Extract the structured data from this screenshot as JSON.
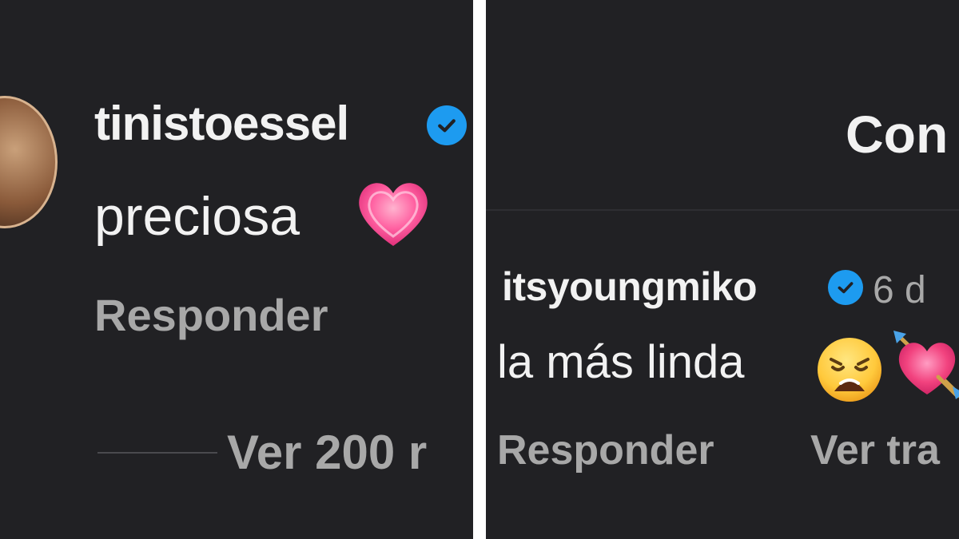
{
  "left": {
    "username": "tinistoessel",
    "comment": "preciosa",
    "comment_emoji": "pink-heart",
    "reply_label": "Responder",
    "view_replies_label": "Ver 200 r"
  },
  "right": {
    "header_title": "Con",
    "username": "itsyoungmiko",
    "time": "6 d",
    "comment": "la más linda",
    "comment_emojis": [
      "weary-face",
      "heart-with-arrow"
    ],
    "reply_label": "Responder",
    "see_translation_label": "Ver tra"
  },
  "colors": {
    "background": "#212124",
    "text_primary": "#f2f2f2",
    "text_secondary": "#a8a8a8",
    "verified_badge": "#1d9bf0",
    "separator": "#ffffff"
  }
}
